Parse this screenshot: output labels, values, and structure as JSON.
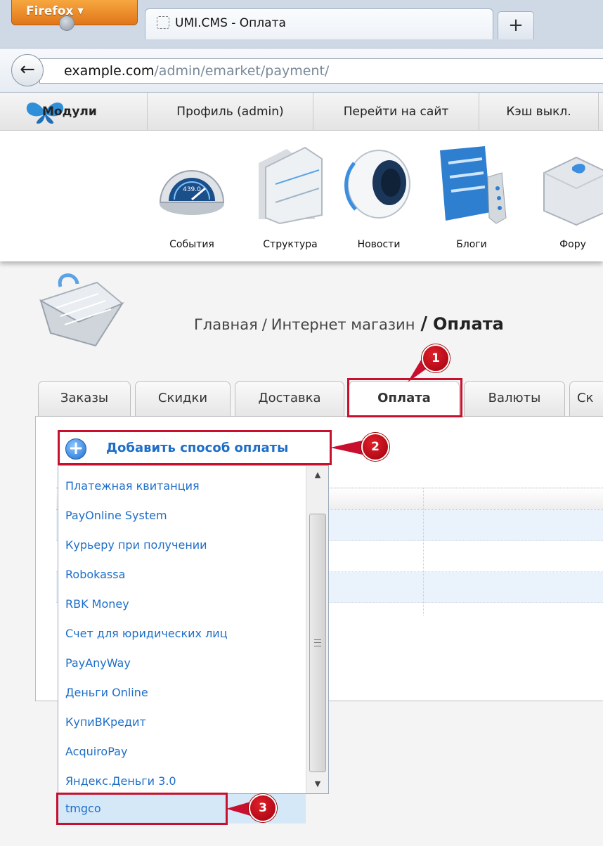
{
  "browser": {
    "app_button": "Firefox",
    "tab_title": "UMI.CMS - Оплата",
    "new_tab": "+",
    "url_domain": "example.com",
    "url_path": "/admin/emarket/payment/"
  },
  "menubar": {
    "modules": "Модули",
    "profile": "Профиль (admin)",
    "site": "Перейти на сайт",
    "cache": "Кэш выкл."
  },
  "modules": {
    "events": "События",
    "structure": "Структура",
    "news": "Новости",
    "blogs": "Блоги",
    "forum": "Фору"
  },
  "breadcrumb": {
    "home": "Главная",
    "separator": "/",
    "section": "Интернет магазин",
    "current": "Оплата"
  },
  "tabs": [
    "Заказы",
    "Скидки",
    "Доставка",
    "Оплата",
    "Валюты",
    "Ск"
  ],
  "add_button": "Добавить способ оплаты",
  "dropdown": {
    "items": [
      "Платежная квитанция",
      "PayOnline System",
      "Курьеру при получении",
      "Robokassa",
      "RBK Money",
      "Счет для юридических лиц",
      "PayAnyWay",
      "Деньги Online",
      "КупиВКредит",
      "AcquiroPay",
      "Яндекс.Деньги 3.0",
      "tmgco"
    ],
    "selected": "tmgco"
  },
  "callouts": [
    "1",
    "2",
    "3"
  ],
  "colors": {
    "accent_red": "#c8102e",
    "link_blue": "#1e6ec8",
    "firefox_orange": "#e0761a"
  }
}
